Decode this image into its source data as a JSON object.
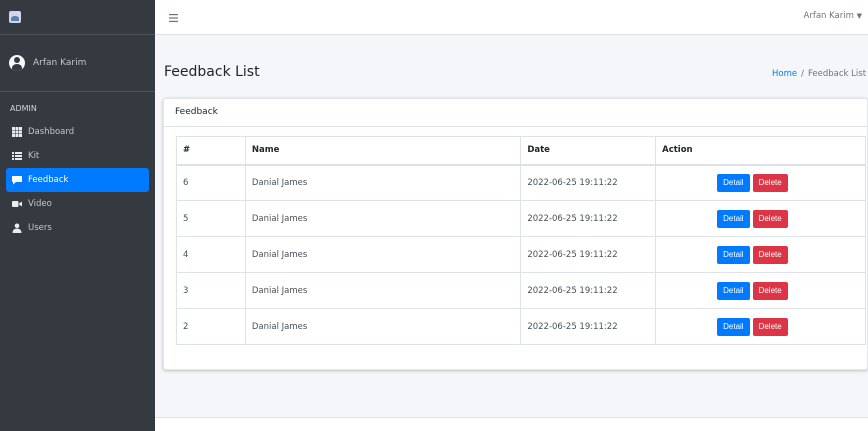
{
  "sidebar": {
    "user_name": "Arfan Karim",
    "section_header": "ADMIN",
    "items": [
      {
        "label": "Dashboard",
        "icon": "grid-icon",
        "active": false
      },
      {
        "label": "Kit",
        "icon": "list-icon",
        "active": false
      },
      {
        "label": "Feedback",
        "icon": "comment-icon",
        "active": true
      },
      {
        "label": "Video",
        "icon": "video-icon",
        "active": false
      },
      {
        "label": "Users",
        "icon": "user-icon",
        "active": false
      }
    ]
  },
  "topbar": {
    "menu_icon": "hamburger-icon",
    "user_label": "Arfan Karim"
  },
  "page": {
    "title": "Feedback List",
    "breadcrumb_home": "Home",
    "breadcrumb_separator": "/",
    "breadcrumb_current": "Feedback List"
  },
  "card": {
    "title": "Feedback",
    "table": {
      "headers": [
        "#",
        "Name",
        "Date",
        "Action"
      ],
      "rows": [
        {
          "num": "6",
          "name": "Danial James",
          "date": "2022-06-25 19:11:22"
        },
        {
          "num": "5",
          "name": "Danial James",
          "date": "2022-06-25 19:11:22"
        },
        {
          "num": "4",
          "name": "Danial James",
          "date": "2022-06-25 19:11:22"
        },
        {
          "num": "3",
          "name": "Danial James",
          "date": "2022-06-25 19:11:22"
        },
        {
          "num": "2",
          "name": "Danial James",
          "date": "2022-06-25 19:11:22"
        }
      ],
      "detail_label": "Detail",
      "delete_label": "Delete"
    }
  },
  "colors": {
    "sidebar_bg": "#343a40",
    "active_bg": "#007bff",
    "detail_btn": "#007bff",
    "delete_btn": "#dc3545"
  }
}
